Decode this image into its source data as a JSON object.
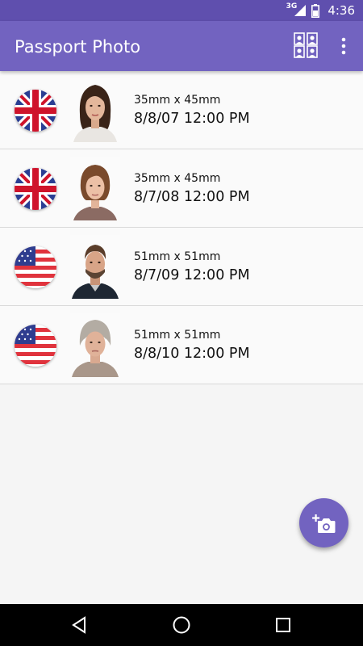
{
  "status_bar": {
    "network": "3G",
    "time": "4:36",
    "icons": [
      "signal-icon",
      "battery-icon"
    ]
  },
  "app_bar": {
    "title": "Passport Photo",
    "actions": [
      "photo-grid-icon",
      "more-options-icon"
    ]
  },
  "photos": [
    {
      "flag": "uk-flag-icon",
      "size": "35mm x 45mm",
      "date": "8/8/07 12:00 PM"
    },
    {
      "flag": "uk-flag-icon",
      "size": "35mm x 45mm",
      "date": "8/7/08 12:00 PM"
    },
    {
      "flag": "us-flag-icon",
      "size": "51mm x 51mm",
      "date": "8/7/09 12:00 PM"
    },
    {
      "flag": "us-flag-icon",
      "size": "51mm x 51mm",
      "date": "8/8/10 12:00 PM"
    }
  ],
  "fab": {
    "icon": "add-photo-camera-icon"
  },
  "nav_bar": {
    "icons": [
      "back-icon",
      "home-icon",
      "recents-icon"
    ]
  },
  "colors": {
    "status_bar": "#5f4fae",
    "app_bar": "#7263c0",
    "accent": "#7263c0",
    "background": "#fafafa"
  }
}
